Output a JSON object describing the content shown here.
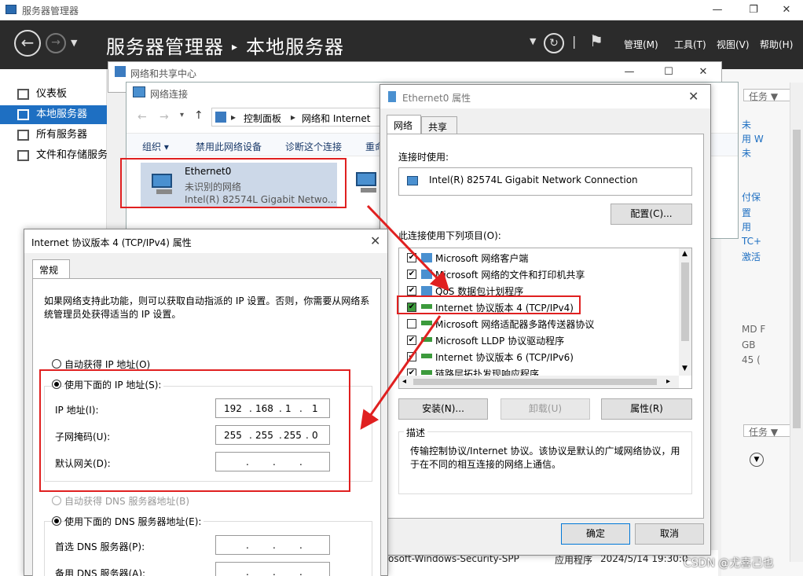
{
  "server_manager": {
    "title": "服务器管理器",
    "breadcrumb_root": "服务器管理器",
    "breadcrumb_sep": "▸",
    "breadcrumb_current": "本地服务器",
    "menus": [
      "管理(M)",
      "工具(T)",
      "视图(V)",
      "帮助(H)"
    ],
    "sidebar": [
      "仪表板",
      "本地服务器",
      "所有服务器",
      "文件和存储服务"
    ],
    "right_strip": {
      "tasks1": "任务",
      "link1": "未",
      "link2": "用 W",
      "link3": "未",
      "link4": "付保",
      "link5": "置",
      "link6": "用",
      "link7": "TC+",
      "link8": "激活",
      "info1": "MD F",
      "info2": "GB",
      "info3": "45 (",
      "tasks2": "任务"
    },
    "bottom_row": {
      "source": "osoft-Windows-Security-SPP",
      "log": "应用程序",
      "date": "2024/5/14 19:30:0"
    },
    "watermark": "CSDN @尤喜己也"
  },
  "nsc": {
    "title": "网络和共享中心"
  },
  "net_connections": {
    "title": "网络连接",
    "address": [
      "控制面板",
      "网络和 Internet",
      "网络连接"
    ],
    "toolbar": [
      "组织 ▾",
      "禁用此网络设备",
      "诊断这个连接",
      "重命"
    ],
    "adapter": {
      "name": "Ethernet0",
      "status": "未识别的网络",
      "device": "Intel(R) 82574L Gigabit Netwo..."
    }
  },
  "eth_props": {
    "title": "Ethernet0 属性",
    "tabs": [
      "网络",
      "共享"
    ],
    "connect_using_label": "连接时使用:",
    "adapter": "Intel(R) 82574L Gigabit Network Connection",
    "configure_btn": "配置(C)...",
    "items_label": "此连接使用下列项目(O):",
    "items": [
      {
        "label": "Microsoft 网络客户端",
        "checked": true
      },
      {
        "label": "Microsoft 网络的文件和打印机共享",
        "checked": true
      },
      {
        "label": "QoS 数据包计划程序",
        "checked": true
      },
      {
        "label": "Internet 协议版本 4 (TCP/IPv4)",
        "checked": true
      },
      {
        "label": "Microsoft 网络适配器多路传送器协议",
        "checked": false
      },
      {
        "label": "Microsoft LLDP 协议驱动程序",
        "checked": true
      },
      {
        "label": "Internet 协议版本 6 (TCP/IPv6)",
        "checked": true
      },
      {
        "label": "链路层拓扑发现响应程序",
        "checked": true
      }
    ],
    "install_btn": "安装(N)...",
    "uninstall_btn": "卸载(U)",
    "properties_btn": "属性(R)",
    "desc_label": "描述",
    "description": "传输控制协议/Internet 协议。该协议是默认的广域网络协议，用于在不同的相互连接的网络上通信。",
    "ok_btn": "确定",
    "cancel_btn": "取消"
  },
  "ipv4": {
    "title": "Internet 协议版本 4 (TCP/IPv4) 属性",
    "tab": "常规",
    "intro": "如果网络支持此功能，则可以获取自动指派的 IP 设置。否则，你需要从网络系统管理员处获得适当的 IP 设置。",
    "auto_ip": "自动获得 IP 地址(O)",
    "manual_ip": "使用下面的 IP 地址(S):",
    "ip_label": "IP 地址(I):",
    "ip_value": [
      "192",
      "168",
      "1",
      "1"
    ],
    "mask_label": "子网掩码(U):",
    "mask_value": [
      "255",
      "255",
      "255",
      "0"
    ],
    "gw_label": "默认网关(D):",
    "auto_dns": "自动获得 DNS 服务器地址(B)",
    "manual_dns": "使用下面的 DNS 服务器地址(E):",
    "pref_dns_label": "首选 DNS 服务器(P):",
    "alt_dns_label": "备用 DNS 服务器(A):"
  },
  "colors": {
    "accent": "#1e6fc2",
    "header": "#2b2b2b",
    "annotation": "#e02020"
  }
}
